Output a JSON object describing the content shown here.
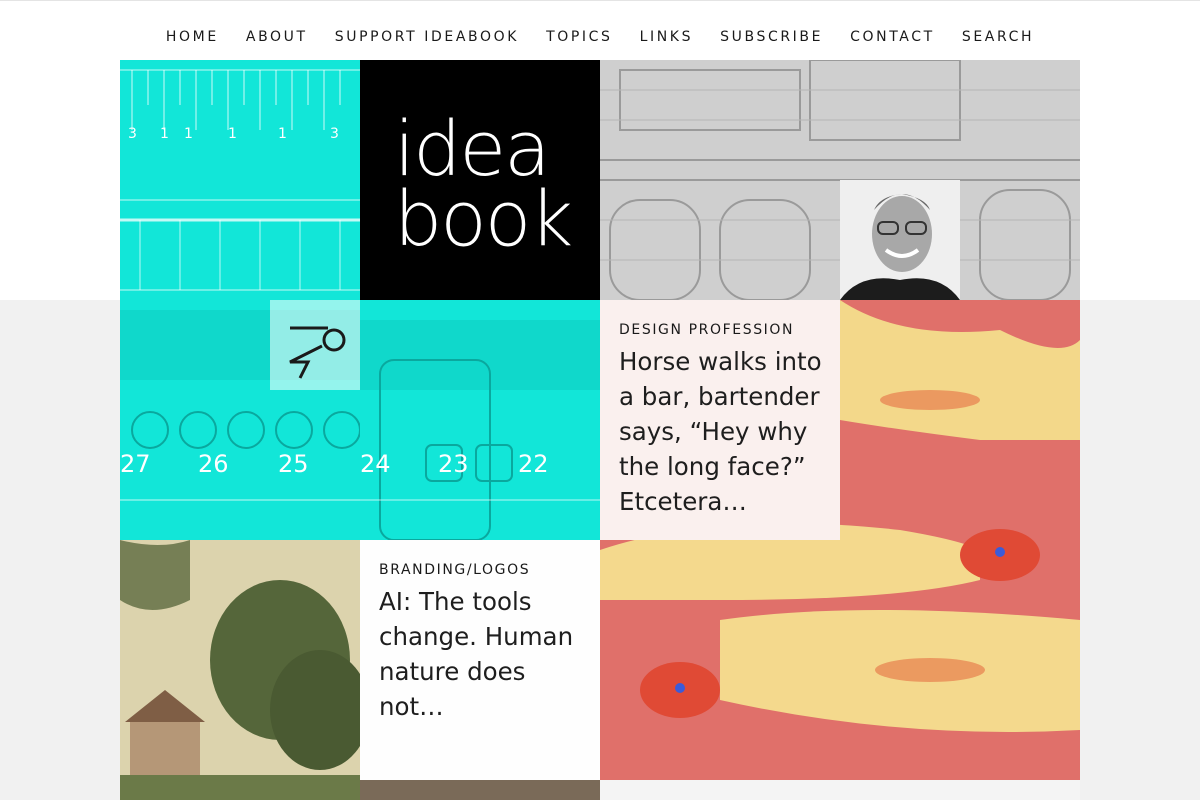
{
  "nav": {
    "items": [
      "HOME",
      "ABOUT",
      "SUPPORT IDEABOOK",
      "TOPICS",
      "LINKS",
      "SUBSCRIBE",
      "CONTACT",
      "SEARCH"
    ]
  },
  "logo": {
    "line1": "idea",
    "line2": "book"
  },
  "ruler_numbers": [
    "27",
    "26",
    "25",
    "24",
    "23",
    "22"
  ],
  "posts": [
    {
      "category": "DESIGN PROFESSION",
      "title": "Horse walks into a bar, bartender says, “Hey why the long face?” Etcetera…"
    },
    {
      "category": "BRANDING/LOGOS",
      "title": "AI: The tools change. Human nature does not…"
    }
  ],
  "colors": {
    "cyan": "#12e6d8",
    "logo_bg": "#000000",
    "chicken_bg": "#e0706a",
    "grey_band": "#f1f1f1"
  }
}
